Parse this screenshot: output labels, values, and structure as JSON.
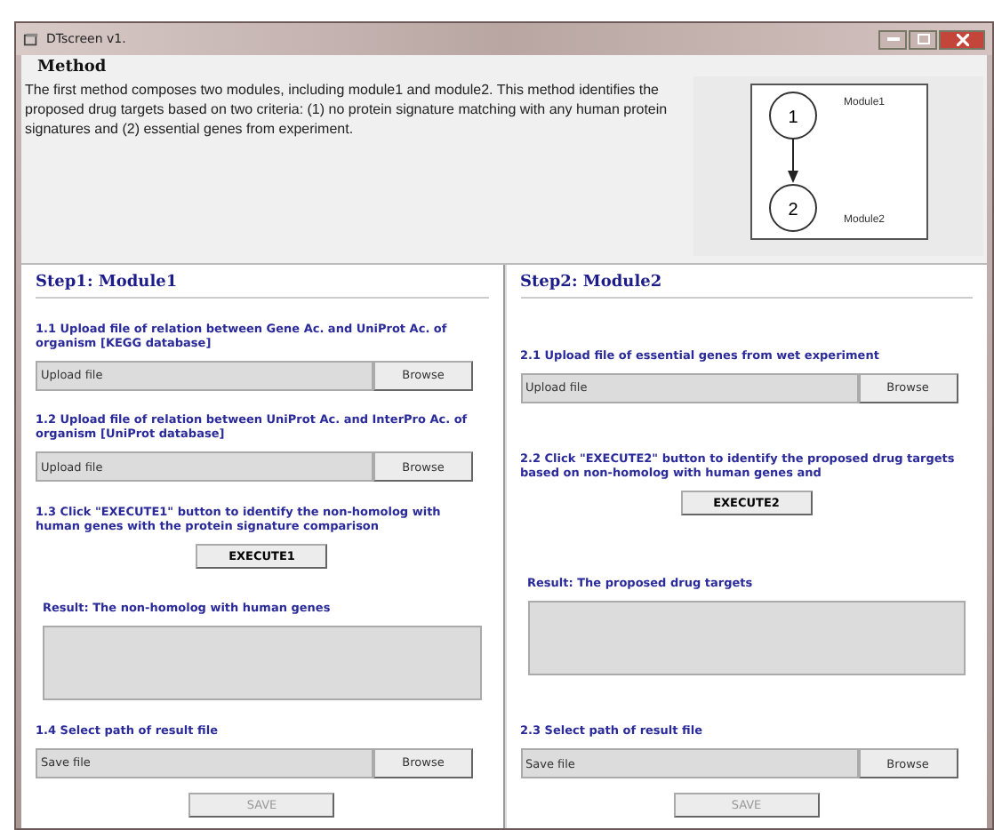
{
  "window": {
    "title": "DTscreen v1."
  },
  "method": {
    "title": "Method",
    "description": "The first method composes two modules, including module1 and module2. This method identifies the proposed drug targets based on two criteria: (1) no protein signature matching with any human protein signatures and (2) essential genes from experiment.",
    "diagram": {
      "nodes": [
        {
          "number": "1",
          "label": "Module1"
        },
        {
          "number": "2",
          "label": "Module2"
        }
      ]
    }
  },
  "steps": [
    {
      "title": "Step1: Module1",
      "items": [
        {
          "kind": "upload",
          "instruction": "1.1 Upload file of relation between Gene Ac. and UniProt Ac. of organism [KEGG database]",
          "placeholder": "Upload file",
          "button": "Browse"
        },
        {
          "kind": "upload",
          "instruction": "1.2 Upload file of relation between UniProt Ac. and InterPro Ac. of organism [UniProt database]",
          "placeholder": "Upload file",
          "button": "Browse"
        },
        {
          "kind": "execute",
          "instruction": "1.3 Click \"EXECUTE1\" button to identify the non-homolog with human genes with the protein signature comparison",
          "button": "EXECUTE1"
        },
        {
          "kind": "result",
          "label": "Result: The non-homolog with human genes"
        },
        {
          "kind": "save",
          "instruction": "1.4 Select path of result file",
          "placeholder": "Save file",
          "button": "Browse",
          "save_button": "SAVE",
          "disabled": true
        }
      ]
    },
    {
      "title": "Step2: Module2",
      "items": [
        {
          "kind": "upload",
          "instruction": "2.1 Upload file of essential genes from wet experiment",
          "placeholder": "Upload file",
          "button": "Browse"
        },
        {
          "kind": "execute",
          "instruction": "2.2 Click \"EXECUTE2\" button to identify the proposed drug targets based on non-homolog with human genes and",
          "button": "EXECUTE2"
        },
        {
          "kind": "result",
          "label": "Result: The proposed drug targets"
        },
        {
          "kind": "save",
          "instruction": "2.3 Select path of result file",
          "placeholder": "Save file",
          "button": "Browse",
          "save_button": "SAVE",
          "disabled": true
        }
      ]
    }
  ]
}
